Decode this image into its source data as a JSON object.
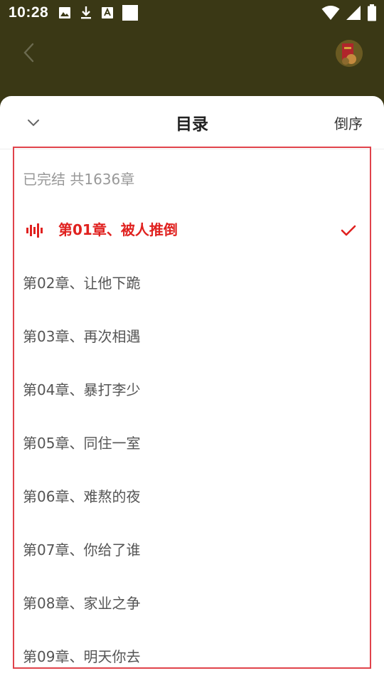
{
  "status_bar": {
    "time": "10:28"
  },
  "toc": {
    "title": "目录",
    "reverse_label": "倒序",
    "status": "已完结 共1636章",
    "accent_color": "#e0211f",
    "chapters": [
      {
        "label": "第01章、被人推倒",
        "active": true
      },
      {
        "label": "第02章、让他下跪",
        "active": false
      },
      {
        "label": "第03章、再次相遇",
        "active": false
      },
      {
        "label": "第04章、暴打李少",
        "active": false
      },
      {
        "label": "第05章、同住一室",
        "active": false
      },
      {
        "label": "第06章、难熬的夜",
        "active": false
      },
      {
        "label": "第07章、你给了谁",
        "active": false
      },
      {
        "label": "第08章、家业之争",
        "active": false
      },
      {
        "label": "第09章、明天你去",
        "active": false
      }
    ]
  }
}
